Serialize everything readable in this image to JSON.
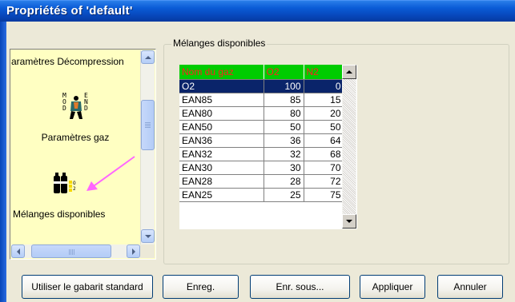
{
  "window": {
    "title": "Propriétés of 'default'"
  },
  "nav": {
    "items": [
      {
        "label": "aramètres Décompression",
        "icon": "decompression-icon"
      },
      {
        "label": "Paramètres gaz",
        "icon": "gas-mixture-diver-icon"
      },
      {
        "label": "Mélanges disponibles",
        "icon": "gas-cylinders-icon"
      }
    ],
    "annotation": {
      "icon": "pink-arrow-icon",
      "color": "#ff66ff"
    }
  },
  "group": {
    "label": "Mélanges disponibles"
  },
  "grid": {
    "columns": [
      "Nom du gaz",
      "O2",
      "N2"
    ],
    "header_bg": "#00cc00",
    "header_fg": "#ff2020",
    "selected_index": 0,
    "rows": [
      {
        "name": "O2",
        "o2": "100",
        "n2": "0"
      },
      {
        "name": "EAN85",
        "o2": "85",
        "n2": "15"
      },
      {
        "name": "EAN80",
        "o2": "80",
        "n2": "20"
      },
      {
        "name": "EAN50",
        "o2": "50",
        "n2": "50"
      },
      {
        "name": "EAN36",
        "o2": "36",
        "n2": "64"
      },
      {
        "name": "EAN32",
        "o2": "32",
        "n2": "68"
      },
      {
        "name": "EAN30",
        "o2": "30",
        "n2": "70"
      },
      {
        "name": "EAN28",
        "o2": "28",
        "n2": "72"
      },
      {
        "name": "EAN25",
        "o2": "25",
        "n2": "75"
      }
    ]
  },
  "buttons": {
    "template": "Utiliser le gabarit standard",
    "save": "Enreg.",
    "save_as": "Enr. sous...",
    "apply": "Appliquer",
    "cancel": "Annuler"
  },
  "colors": {
    "nav_bg": "#ffffc2",
    "selection": "#0a246a",
    "titlebar": "#0a5bd6"
  }
}
